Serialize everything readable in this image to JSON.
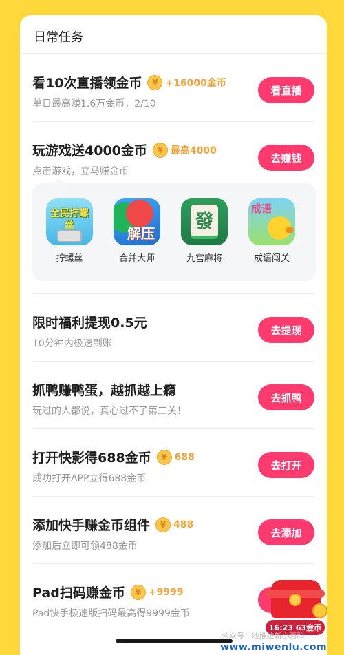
{
  "section_title": "日常任务",
  "tasks": [
    {
      "title": "看10次直播领金币",
      "coin": "+16000金币",
      "subtitle": "单日最高赚1.6万金币，2/10",
      "button": "看直播"
    },
    {
      "title": "玩游戏送4000金币",
      "coin": "最高4000",
      "subtitle": "点击游戏，立马赚金币",
      "button": "去赚钱"
    },
    {
      "title": "限时福利提现0.5元",
      "coin": "",
      "subtitle": "10分钟内极速到账",
      "button": "去提现"
    },
    {
      "title": "抓鸭赚鸭蛋，越抓越上瘾",
      "coin": "",
      "subtitle": "玩过的人都说，真心过不了第二关！",
      "button": "去抓鸭"
    },
    {
      "title": "打开快影得688金币",
      "coin": "688",
      "subtitle": "成功打开APP立得688金币",
      "button": "去打开"
    },
    {
      "title": "添加快手赚金币组件",
      "coin": "488",
      "subtitle": "添加后立即可领488金币",
      "button": "去添加"
    },
    {
      "title": "Pad扫码赚金币",
      "coin": "+9999",
      "subtitle": "Pad快手极速版扫码最高得9999金币",
      "button": ""
    }
  ],
  "coin_symbol": "¥",
  "games": [
    {
      "label": "拧螺丝",
      "icon_text": "全民拧螺丝",
      "icon": "screw-game-icon"
    },
    {
      "label": "合并大师",
      "icon_text": "解压",
      "icon": "merge-game-icon"
    },
    {
      "label": "九宫麻将",
      "icon_text": "發",
      "icon": "mahjong-game-icon"
    },
    {
      "label": "成语闯关",
      "icon_text": "成语",
      "icon": "idiom-game-icon"
    }
  ],
  "floating": {
    "timer": "16:23 63金币"
  },
  "watermark": {
    "account": "公众号 · 地推拉新小百科",
    "site": "www.miwenlu.com"
  },
  "colors": {
    "background": "#FFD93A",
    "button": "#FF3A6E",
    "coin": "#F2A33A"
  }
}
